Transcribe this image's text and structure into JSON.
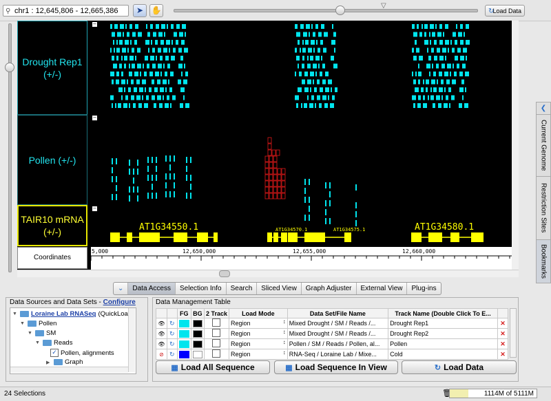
{
  "toolbar": {
    "location": "chr1 : 12,645,806 - 12,665,386",
    "load_data_label": "Load Data"
  },
  "tracks": {
    "drought_label": "Drought Rep1 (+/-)",
    "pollen_label": "Pollen (+/-)",
    "tair_label": "TAIR10 mRNA (+/-)",
    "coords_label": "Coordinates",
    "colors": {
      "reads": "#00e5ee",
      "mismatch": "#e01818",
      "gene": "#ffff00",
      "label_border": "#e8e800"
    }
  },
  "genes": [
    {
      "name": "AT1G34550.1"
    },
    {
      "name": "AT1G34570.1"
    },
    {
      "name": "AT1G34575.1"
    },
    {
      "name": "AT1G34580.1"
    }
  ],
  "ruler": {
    "ticks": [
      "5,000",
      "12,650,000",
      "12,655,000",
      "12,660,000"
    ]
  },
  "side_tabs": [
    "Current Genome",
    "Restriction Sites",
    "Bookmarks"
  ],
  "tabs": [
    "Data Access",
    "Selection Info",
    "Search",
    "Sliced View",
    "Graph Adjuster",
    "External View",
    "Plug-ins"
  ],
  "data_sources": {
    "title": "Data Sources and Data Sets - ",
    "configure": "Configure",
    "tree": [
      {
        "label": "Loraine Lab RNASeq",
        "suffix": " (QuickLoad)"
      },
      {
        "label": "Pollen"
      },
      {
        "label": "SM"
      },
      {
        "label": "Reads"
      },
      {
        "label": "Pollen, alignments"
      },
      {
        "label": "Graph"
      }
    ]
  },
  "table": {
    "title": "Data Management Table",
    "headers": [
      "FG",
      "BG",
      "2 Track",
      "Load Mode",
      "Data Set/File Name",
      "Track Name (Double Click To E..."
    ],
    "rows": [
      {
        "fg": "#00e5ee",
        "bg": "#000000",
        "mode": "Region",
        "file": "Mixed Drought / SM / Reads /...",
        "track": "Drought Rep1"
      },
      {
        "fg": "#00e5ee",
        "bg": "#000000",
        "mode": "Region",
        "file": "Mixed Drought / SM / Reads /...",
        "track": "Drought Rep2"
      },
      {
        "fg": "#00e5ee",
        "bg": "#000000",
        "mode": "Region",
        "file": "Pollen / SM / Reads / Pollen, al...",
        "track": "Pollen"
      },
      {
        "fg": "#0000ff",
        "bg": "#ffffff",
        "mode": "Region",
        "file": "RNA-Seq / Loraine Lab / Mixe...",
        "track": "Cold"
      }
    ]
  },
  "buttons": {
    "load_all": "Load All Sequence",
    "load_view": "Load Sequence In View",
    "load_data": "Load Data"
  },
  "status": {
    "selections": "24 Selections",
    "memory": "1114M of 5111M",
    "memory_fraction": 0.218
  }
}
